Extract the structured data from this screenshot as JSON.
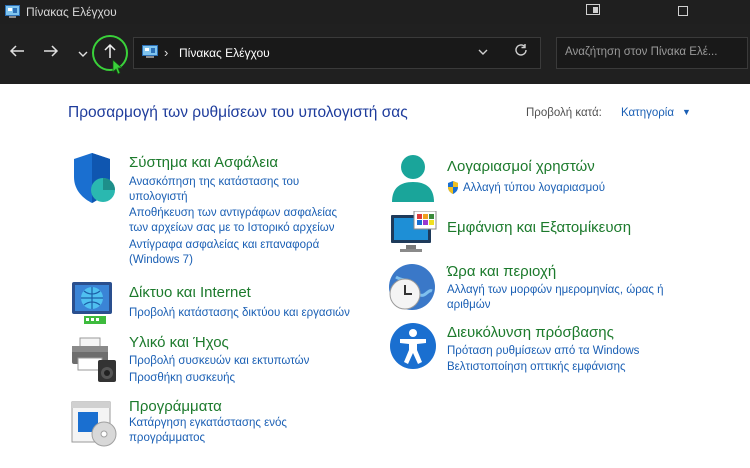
{
  "window": {
    "title": "Πίνακας Ελέγχου"
  },
  "address": {
    "path": "Πίνακας Ελέγχου",
    "separator": "›"
  },
  "search": {
    "placeholder": "Αναζήτηση στον Πίνακα Ελέ..."
  },
  "header": {
    "heading": "Προσαρμογή των ρυθμίσεων του υπολογιστή σας",
    "view_by_label": "Προβολή κατά:",
    "view_by_value": "Κατηγορία"
  },
  "categories_left": [
    {
      "title": "Σύστημα και Ασφάλεια",
      "links": [
        "Ανασκόπηση της κατάστασης του",
        "υπολογιστή",
        "Αποθήκευση των αντιγράφων ασφαλείας",
        "των αρχείων σας με το Ιστορικό αρχείων",
        "Αντίγραφα ασφαλείας και επαναφορά",
        "(Windows 7)"
      ]
    },
    {
      "title": "Δίκτυο και Internet",
      "links": [
        "Προβολή κατάστασης δικτύου και εργασιών"
      ]
    },
    {
      "title": "Υλικό και Ήχος",
      "links": [
        "Προβολή συσκευών και εκτυπωτών",
        "Προσθήκη συσκευής"
      ]
    },
    {
      "title": "Προγράμματα",
      "links": [
        "Κατάργηση εγκατάστασης ενός",
        "προγράμματος"
      ]
    }
  ],
  "categories_right": [
    {
      "title": "Λογαριασμοί χρηστών",
      "links": [
        "Αλλαγή τύπου λογαριασμού"
      ]
    },
    {
      "title": "Εμφάνιση και Εξατομίκευση",
      "links": []
    },
    {
      "title": "Ώρα και περιοχή",
      "links": [
        "Αλλαγή των μορφών ημερομηνίας, ώρας ή",
        "αριθμών"
      ]
    },
    {
      "title": "Διευκόλυνση πρόσβασης",
      "links": [
        "Πρόταση ρυθμίσεων από τα Windows",
        "Βελτιστοποίηση οπτικής εμφάνισης"
      ]
    }
  ]
}
